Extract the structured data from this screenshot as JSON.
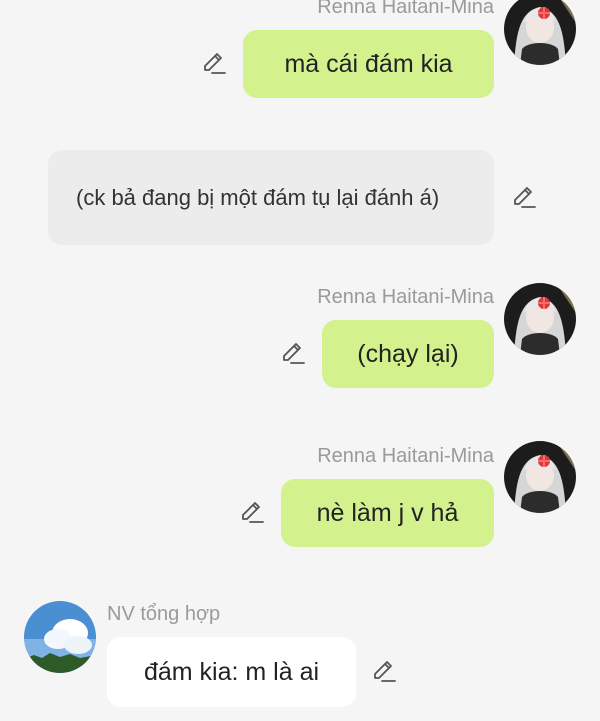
{
  "messages": [
    {
      "sender": "Renna Haitani-Mina",
      "text": "mà cái đám kia"
    },
    {
      "text": "(ck bả đang bị một đám tụ lại đánh á)"
    },
    {
      "sender": "Renna Haitani-Mina",
      "text": "(chạy lại)"
    },
    {
      "sender": "Renna Haitani-Mina",
      "text": "nè làm j v hả"
    },
    {
      "sender": "NV tổng hợp",
      "text": "đám kia: m là ai"
    }
  ],
  "icons": {
    "edit": "pencil-edit-icon",
    "avatar_character": "anime-character-avatar",
    "avatar_sky": "sky-cloud-avatar"
  },
  "colors": {
    "background": "#f5f5f5",
    "user_bubble": "#d3f28d",
    "narration_bubble": "#ececec",
    "npc_bubble": "#ffffff",
    "sender_text": "#9a9a9a"
  }
}
